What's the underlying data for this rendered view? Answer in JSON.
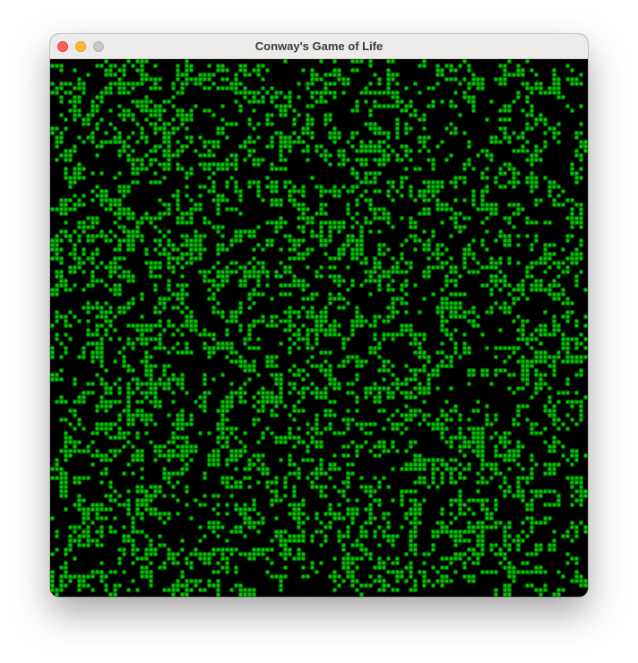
{
  "window": {
    "title": "Conway's Game of Life"
  },
  "board": {
    "columns": 120,
    "rows": 120,
    "live_color": "#00d400",
    "dead_color": "#000000",
    "density": 0.24
  },
  "colors": {
    "titlebar_bg": "#ecebea",
    "close": "#fe5f57",
    "minimize": "#febb2e",
    "zoom": "#c8c7c6"
  }
}
